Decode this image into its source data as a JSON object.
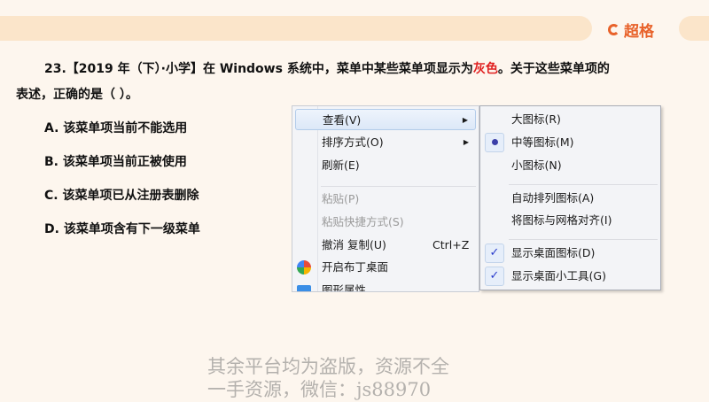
{
  "header": {
    "logo_text": "超格"
  },
  "question": {
    "prefix": "23.【2019 年（下）·小学】在 Windows 系统中，菜单中某些菜单项显示为",
    "highlight": "灰色",
    "suffix": "。关于这些菜单项的",
    "line2": "表述，正确的是（ ）。"
  },
  "options": [
    "A. 该菜单项当前不能选用",
    "B. 该菜单项当前正被使用",
    "C. 该菜单项已从注册表删除",
    "D. 该菜单项含有下一级菜单"
  ],
  "menu": {
    "items": [
      {
        "label": "查看(V)",
        "arrow": "▶"
      },
      {
        "label": "排序方式(O)",
        "arrow": "▶"
      },
      {
        "label": "刷新(E)"
      },
      {
        "label": "粘贴(P)"
      },
      {
        "label": "粘贴快捷方式(S)"
      },
      {
        "label": "撤消 复制(U)",
        "shortcut": "Ctrl+Z"
      },
      {
        "label": "开启布丁桌面"
      },
      {
        "label": "图形属性"
      }
    ]
  },
  "submenu": {
    "items": [
      {
        "label": "大图标(R)"
      },
      {
        "label": "中等图标(M)"
      },
      {
        "label": "小图标(N)"
      },
      {
        "label": "自动排列图标(A)"
      },
      {
        "label": "将图标与网格对齐(I)"
      },
      {
        "label": "显示桌面图标(D)",
        "check": "✓"
      },
      {
        "label": "显示桌面小工具(G)",
        "check": "✓"
      }
    ]
  },
  "watermark": {
    "line1": "其余平台均为盗版，资源不全",
    "line2": "一手资源，微信：js88970"
  }
}
